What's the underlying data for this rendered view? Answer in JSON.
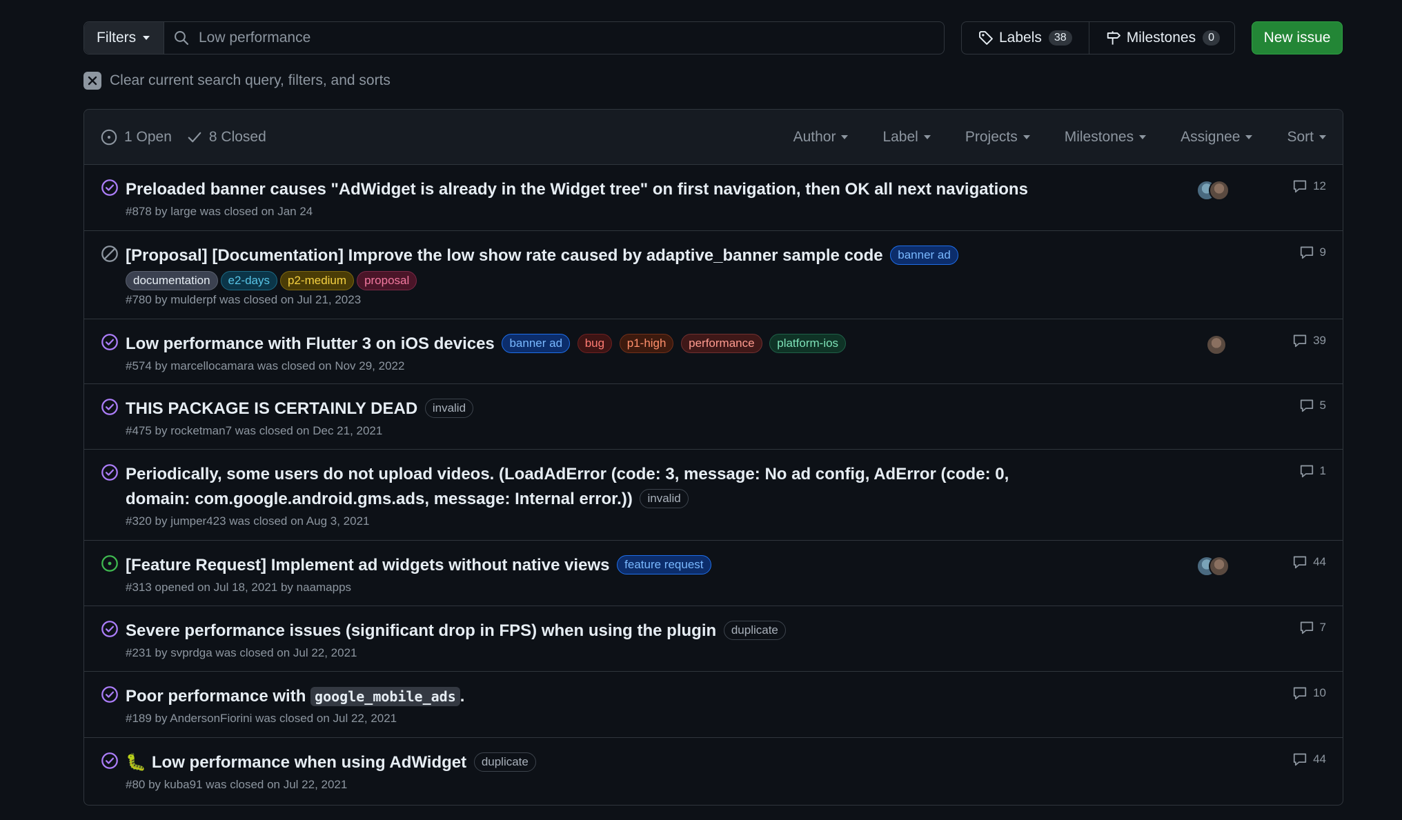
{
  "toolbar": {
    "filters_label": "Filters",
    "search_value": "Low performance",
    "labels_label": "Labels",
    "labels_count": "38",
    "milestones_label": "Milestones",
    "milestones_count": "0",
    "new_issue_label": "New issue"
  },
  "clear_text": "Clear current search query, filters, and sorts",
  "header": {
    "open_label": "1 Open",
    "closed_label": "8 Closed",
    "filters": [
      "Author",
      "Label",
      "Projects",
      "Milestones",
      "Assignee",
      "Sort"
    ]
  },
  "colors": {
    "closed_icon": "#ab7df8",
    "not_planned_icon": "#8d96a0",
    "open_icon": "#3fb950",
    "new_issue_bg": "#238636"
  },
  "issues": [
    {
      "state": "closed",
      "title": "Preloaded banner causes \"AdWidget is already in the Widget tree\" on first navigation, then OK all next navigations",
      "meta": "#878 by large was closed on Jan 24",
      "comments": "12",
      "avatars": 2
    },
    {
      "state": "not_planned",
      "title": "[Proposal] [Documentation] Improve the low show rate caused by adaptive_banner sample code",
      "inline_labels": [
        {
          "text": "banner ad",
          "fg": "#79b8ff",
          "bg": "#0c2d6b",
          "border": "#1f6feb"
        }
      ],
      "labels_line": [
        {
          "text": "documentation",
          "fg": "#e6edf3",
          "bg": "#3b4150",
          "border": "#59606e"
        },
        {
          "text": "e2-days",
          "fg": "#58c4e6",
          "bg": "#0b3548",
          "border": "#1d6a85"
        },
        {
          "text": "p2-medium",
          "fg": "#f5d142",
          "bg": "#4a3c06",
          "border": "#7d6710"
        },
        {
          "text": "proposal",
          "fg": "#f2789f",
          "bg": "#4a1528",
          "border": "#7a2946"
        }
      ],
      "meta": "#780 by mulderpf was closed on Jul 21, 2023",
      "comments": "9",
      "avatars": 0
    },
    {
      "state": "closed",
      "title": "Low performance with Flutter 3 on iOS devices",
      "inline_labels": [
        {
          "text": "banner ad",
          "fg": "#79b8ff",
          "bg": "#0c2d6b",
          "border": "#1f6feb"
        },
        {
          "text": "bug",
          "fg": "#ff7b72",
          "bg": "#3d1414",
          "border": "#6e2121"
        },
        {
          "text": "p1-high",
          "fg": "#ff8f6b",
          "bg": "#3d1a0e",
          "border": "#72301a"
        },
        {
          "text": "performance",
          "fg": "#ff9b8f",
          "bg": "#3f1818",
          "border": "#703030"
        },
        {
          "text": "platform-ios",
          "fg": "#7ee2b8",
          "bg": "#0f3326",
          "border": "#1f6148"
        }
      ],
      "meta": "#574 by marcellocamara was closed on Nov 29, 2022",
      "comments": "39",
      "avatars": 1
    },
    {
      "state": "closed",
      "title": "THIS PACKAGE IS CERTAINLY DEAD",
      "inline_labels": [
        {
          "text": "invalid",
          "fg": "#a8b0ba",
          "bg": "#0d1117",
          "border": "#3d444d"
        }
      ],
      "meta": "#475 by rocketman7 was closed on Dec 21, 2021",
      "comments": "5",
      "avatars": 0
    },
    {
      "state": "closed",
      "title": "Periodically, some users do not upload videos. (LoadAdError (code: 3, message: No ad config, AdError (code: 0, domain: com.google.android.gms.ads, message: Internal error.))",
      "inline_labels": [
        {
          "text": "invalid",
          "fg": "#a8b0ba",
          "bg": "#0d1117",
          "border": "#3d444d"
        }
      ],
      "meta": "#320 by jumper423 was closed on Aug 3, 2021",
      "comments": "1",
      "avatars": 0
    },
    {
      "state": "open",
      "title": "[Feature Request] Implement ad widgets without native views",
      "inline_labels": [
        {
          "text": "feature request",
          "fg": "#79b8ff",
          "bg": "#0c2d6b",
          "border": "#1f6feb"
        }
      ],
      "meta": "#313 opened on Jul 18, 2021 by naamapps",
      "comments": "44",
      "avatars": 2
    },
    {
      "state": "closed",
      "title": "Severe performance issues (significant drop in FPS) when using the plugin",
      "inline_labels": [
        {
          "text": "duplicate",
          "fg": "#a8b0ba",
          "bg": "#0d1117",
          "border": "#3d444d"
        }
      ],
      "meta": "#231 by svprdga was closed on Jul 22, 2021",
      "comments": "7",
      "avatars": 0
    },
    {
      "state": "closed",
      "title_prefix": "Poor performance with ",
      "title_code": "google_mobile_ads",
      "title_suffix": ".",
      "meta": "#189 by AndersonFiorini was closed on Jul 22, 2021",
      "comments": "10",
      "avatars": 0
    },
    {
      "state": "closed",
      "emoji": "🐛",
      "title": "Low performance when using AdWidget",
      "inline_labels": [
        {
          "text": "duplicate",
          "fg": "#a8b0ba",
          "bg": "#0d1117",
          "border": "#3d444d"
        }
      ],
      "meta": "#80 by kuba91 was closed on Jul 22, 2021",
      "comments": "44",
      "avatars": 0
    }
  ]
}
